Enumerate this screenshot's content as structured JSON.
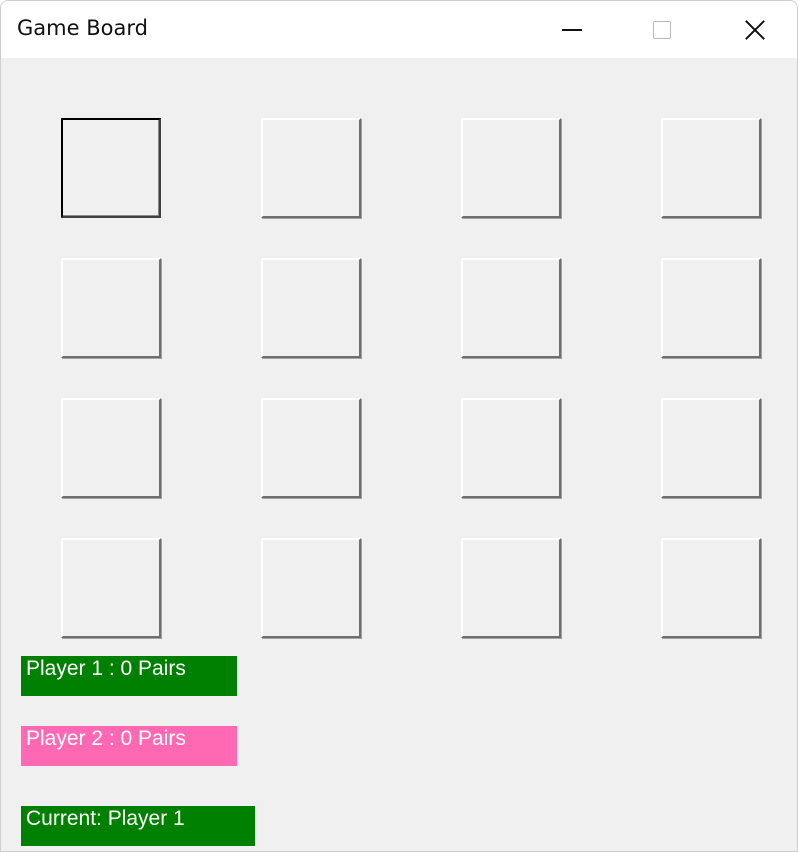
{
  "window": {
    "title": "Game Board",
    "controls": {
      "minimize": "minimize",
      "maximize": "maximize",
      "close": "close"
    }
  },
  "board": {
    "rows": 4,
    "cols": 4,
    "focused_tile": 0
  },
  "status": {
    "player1": "Player 1 : 0 Pairs",
    "player2": "Player 2 : 0 Pairs",
    "current": "Current: Player 1"
  },
  "colors": {
    "player1": "#008000",
    "player2": "#ff69b4",
    "current": "#008000",
    "background": "#f0f0f0"
  }
}
